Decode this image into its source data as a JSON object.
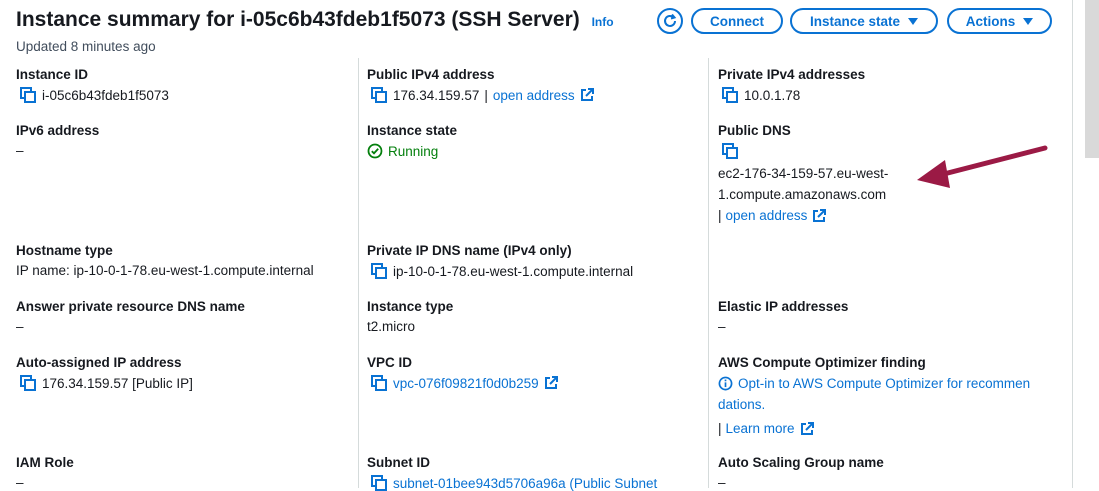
{
  "header": {
    "title": "Instance summary for i-05c6b43fdeb1f5073 (SSH Server)",
    "info": "Info",
    "updated": "Updated 8 minutes ago",
    "connect": "Connect",
    "instance_state": "Instance state",
    "actions": "Actions"
  },
  "fields": {
    "instance_id": {
      "label": "Instance ID",
      "value": "i-05c6b43fdeb1f5073"
    },
    "public_ipv4": {
      "label": "Public IPv4 address",
      "value": "176.34.159.57",
      "sep": "|",
      "link": "open address"
    },
    "private_ipv4": {
      "label": "Private IPv4 addresses",
      "value": "10.0.1.78"
    },
    "ipv6": {
      "label": "IPv6 address",
      "value": "–"
    },
    "instance_state": {
      "label": "Instance state",
      "value": "Running"
    },
    "public_dns": {
      "label": "Public DNS",
      "value_line1": "ec2-176-34-159-57.eu-west-",
      "value_line2": "1.compute.amazonaws.com",
      "sep": "|",
      "link": "open address"
    },
    "hostname_type": {
      "label": "Hostname type",
      "value": "IP name: ip-10-0-1-78.eu-west-1.compute.internal"
    },
    "private_ip_dns": {
      "label": "Private IP DNS name (IPv4 only)",
      "value": "ip-10-0-1-78.eu-west-1.compute.internal"
    },
    "answer_private_dns": {
      "label": "Answer private resource DNS name",
      "value": "–"
    },
    "instance_type": {
      "label": "Instance type",
      "value": "t2.micro"
    },
    "elastic_ip": {
      "label": "Elastic IP addresses",
      "value": "–"
    },
    "auto_assigned_ip": {
      "label": "Auto-assigned IP address",
      "value": "176.34.159.57 [Public IP]"
    },
    "vpc_id": {
      "label": "VPC ID",
      "value": "vpc-076f09821f0d0b259"
    },
    "compute_optimizer": {
      "label": "AWS Compute Optimizer finding",
      "line1": "Opt-in to AWS Compute Optimizer for recommen",
      "line2": "dations.",
      "sep": "|",
      "link": "Learn more"
    },
    "iam_role": {
      "label": "IAM Role",
      "value": "–"
    },
    "subnet_id": {
      "label": "Subnet ID",
      "value": "subnet-01bee943d5706a96a (Public Subnet"
    },
    "asg_name": {
      "label": "Auto Scaling Group name",
      "value": "–"
    }
  },
  "colors": {
    "link": "#0972d3",
    "running": "#037f0c",
    "arrow": "#9b1a45"
  }
}
